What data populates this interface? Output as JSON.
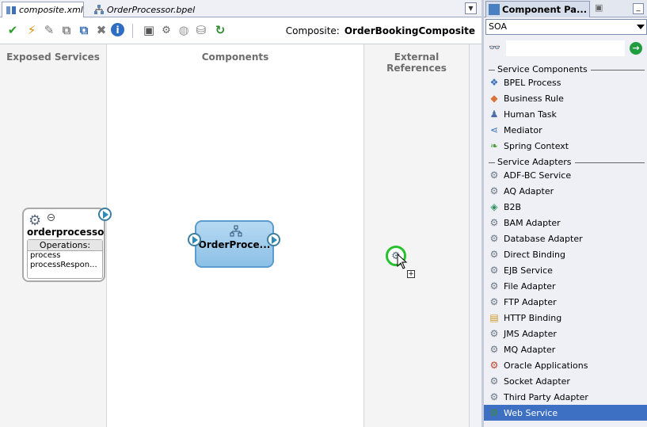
{
  "editor": {
    "tabs": [
      {
        "label": "composite.xml",
        "active": true
      },
      {
        "label": "OrderProcessor.bpel",
        "active": false
      }
    ],
    "composite_label": "Composite:",
    "composite_name": "OrderBookingComposite",
    "lanes": {
      "exposed": "Exposed Services",
      "components": "Components",
      "external": "External References"
    },
    "service": {
      "name": "orderprocesso...",
      "operations_header": "Operations:",
      "operations": [
        "process",
        "processRespon..."
      ]
    },
    "component": {
      "name": "OrderProce..."
    },
    "toolbar_icons": [
      "validate-icon",
      "lightning-icon",
      "wrench-icon",
      "copy-icon",
      "paste-icon",
      "delete-icon",
      "info-icon",
      "layout-icon",
      "hierarchy-icon",
      "refresh-icon",
      "deploy-icon",
      "test-icon"
    ]
  },
  "palette": {
    "title": "Component Pa...",
    "selected_category": "SOA",
    "section_components": "Service Components",
    "components": [
      {
        "label": "BPEL Process",
        "icon": "bpel-icon"
      },
      {
        "label": "Business Rule",
        "icon": "business-rule-icon"
      },
      {
        "label": "Human Task",
        "icon": "human-task-icon"
      },
      {
        "label": "Mediator",
        "icon": "mediator-icon"
      },
      {
        "label": "Spring Context",
        "icon": "spring-icon"
      }
    ],
    "section_adapters": "Service Adapters",
    "adapters": [
      {
        "label": "ADF-BC Service",
        "icon": "gear-icon"
      },
      {
        "label": "AQ Adapter",
        "icon": "gear-icon"
      },
      {
        "label": "B2B",
        "icon": "b2b-icon"
      },
      {
        "label": "BAM Adapter",
        "icon": "gear-icon"
      },
      {
        "label": "Database Adapter",
        "icon": "gear-icon"
      },
      {
        "label": "Direct Binding",
        "icon": "gear-icon"
      },
      {
        "label": "EJB Service",
        "icon": "gear-icon"
      },
      {
        "label": "File Adapter",
        "icon": "gear-icon"
      },
      {
        "label": "FTP Adapter",
        "icon": "gear-icon"
      },
      {
        "label": "HTTP Binding",
        "icon": "http-icon"
      },
      {
        "label": "JMS Adapter",
        "icon": "gear-icon"
      },
      {
        "label": "MQ Adapter",
        "icon": "gear-icon"
      },
      {
        "label": "Oracle Applications",
        "icon": "oracle-icon"
      },
      {
        "label": "Socket Adapter",
        "icon": "gear-icon"
      },
      {
        "label": "Third Party Adapter",
        "icon": "gear-icon"
      },
      {
        "label": "Web Service",
        "icon": "web-service-icon",
        "selected": true
      }
    ]
  }
}
